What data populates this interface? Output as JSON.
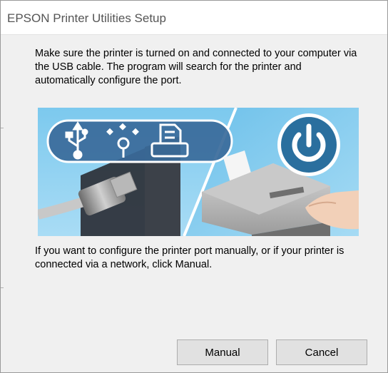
{
  "window": {
    "title": "EPSON Printer Utilities Setup"
  },
  "main": {
    "intro_text": "Make sure the printer is turned on and connected to your computer via the USB cable. The program will search for the printer and automatically configure the port.",
    "manual_text": "If you want to configure the printer port manually, or if your printer is connected via a network, click Manual."
  },
  "illustration": {
    "icons": [
      "usb-icon",
      "firewire-icon",
      "printer-port-icon",
      "power-icon"
    ],
    "colors": {
      "sky": "#8fd0f0",
      "pill": "#3a6a9a",
      "power_circle": "#2a6f9e"
    }
  },
  "buttons": {
    "manual_label": "Manual",
    "cancel_label": "Cancel"
  }
}
